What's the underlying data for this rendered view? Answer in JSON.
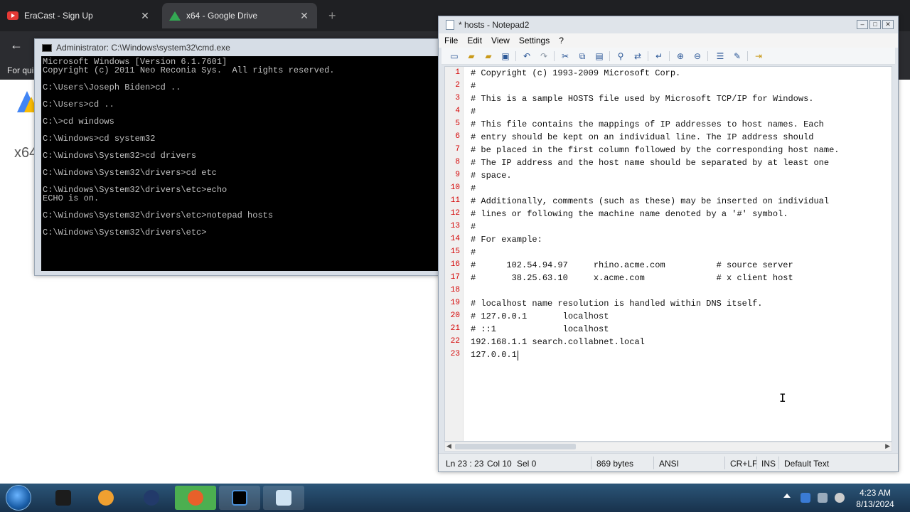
{
  "browser": {
    "tabs": [
      {
        "title": "EraCast - Sign Up",
        "icon": "youtube-icon"
      },
      {
        "title": "x64 - Google Drive",
        "icon": "google-drive-icon"
      }
    ],
    "new_tab": "+",
    "bookmark_partial": "For qui",
    "page_partial": "x64"
  },
  "cmd": {
    "title": "Administrator: C:\\Windows\\system32\\cmd.exe",
    "lines": [
      "Microsoft Windows [Version 6.1.7601]",
      "Copyright (c) 2011 Neo Reconia Sys.  All rights reserved.",
      "C:\\Users\\Joseph Biden>cd ..",
      "C:\\Users>cd ..",
      "C:\\>cd windows",
      "C:\\Windows>cd system32",
      "C:\\Windows\\System32>cd drivers",
      "C:\\Windows\\System32\\drivers>cd etc",
      "C:\\Windows\\System32\\drivers\\etc>echo",
      "ECHO is on.",
      "C:\\Windows\\System32\\drivers\\etc>notepad hosts",
      "C:\\Windows\\System32\\drivers\\etc>"
    ]
  },
  "notepad": {
    "title": "* hosts - Notepad2",
    "menu": [
      "File",
      "Edit",
      "View",
      "Settings",
      "?"
    ],
    "lines": [
      "# Copyright (c) 1993-2009 Microsoft Corp.",
      "#",
      "# This is a sample HOSTS file used by Microsoft TCP/IP for Windows.",
      "#",
      "# This file contains the mappings of IP addresses to host names. Each",
      "# entry should be kept on an individual line. The IP address should",
      "# be placed in the first column followed by the corresponding host name.",
      "# The IP address and the host name should be separated by at least one",
      "# space.",
      "#",
      "# Additionally, comments (such as these) may be inserted on individual",
      "# lines or following the machine name denoted by a '#' symbol.",
      "#",
      "# For example:",
      "#",
      "#      102.54.94.97     rhino.acme.com          # source server",
      "#       38.25.63.10     x.acme.com              # x client host",
      "",
      "# localhost name resolution is handled within DNS itself.",
      "# 127.0.0.1       localhost",
      "# ::1             localhost",
      "192.168.1.1 search.collabnet.local",
      "127.0.0.1"
    ],
    "line_numbers": [
      "1",
      "2",
      "3",
      "4",
      "5",
      "6",
      "7",
      "8",
      "9",
      "10",
      "11",
      "12",
      "13",
      "14",
      "15",
      "16",
      "17",
      "18",
      "19",
      "20",
      "21",
      "22",
      "23"
    ],
    "status": {
      "position": "Ln 23 : 23",
      "column": "Col 10",
      "selection": "Sel 0",
      "size": "869 bytes",
      "encoding": "ANSI",
      "line_endings": "CR+LF",
      "mode": "INS",
      "scheme": "Default Text"
    }
  },
  "taskbar": {
    "time": "4:23 AM",
    "date": "8/13/2024"
  }
}
